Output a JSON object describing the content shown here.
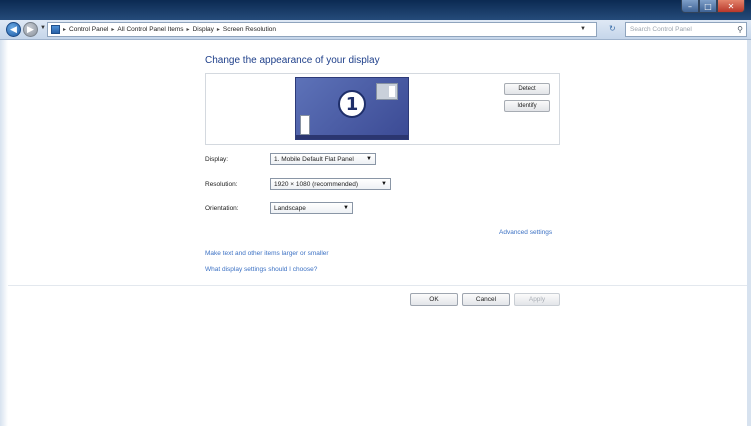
{
  "window": {
    "controls": {
      "minimize": "–",
      "maximize": "□",
      "close": "✕"
    }
  },
  "navigation": {
    "back_icon": "back-arrow-icon",
    "forward_icon": "forward-arrow-icon",
    "breadcrumbs": [
      "Control Panel",
      "All Control Panel Items",
      "Display",
      "Screen Resolution"
    ],
    "search_placeholder": "Search Control Panel"
  },
  "main": {
    "title": "Change the appearance of your display",
    "monitor_number": "1",
    "detect_label": "Detect",
    "identify_label": "Identify",
    "display_label": "Display:",
    "display_value": "1. Mobile Default Flat Panel",
    "resolution_label": "Resolution:",
    "resolution_value": "1920 × 1080 (recommended)",
    "orientation_label": "Orientation:",
    "orientation_value": "Landscape",
    "advanced_settings": "Advanced settings",
    "link_text_size": "Make text and other items larger or smaller",
    "link_settings_help": "What display settings should I choose?"
  },
  "buttons": {
    "ok": "OK",
    "cancel": "Cancel",
    "apply": "Apply"
  },
  "colors": {
    "title_bar": "#0b2a52",
    "link": "#3d72c4",
    "heading": "#1e3f8a",
    "monitor": "#4d5fa6"
  }
}
